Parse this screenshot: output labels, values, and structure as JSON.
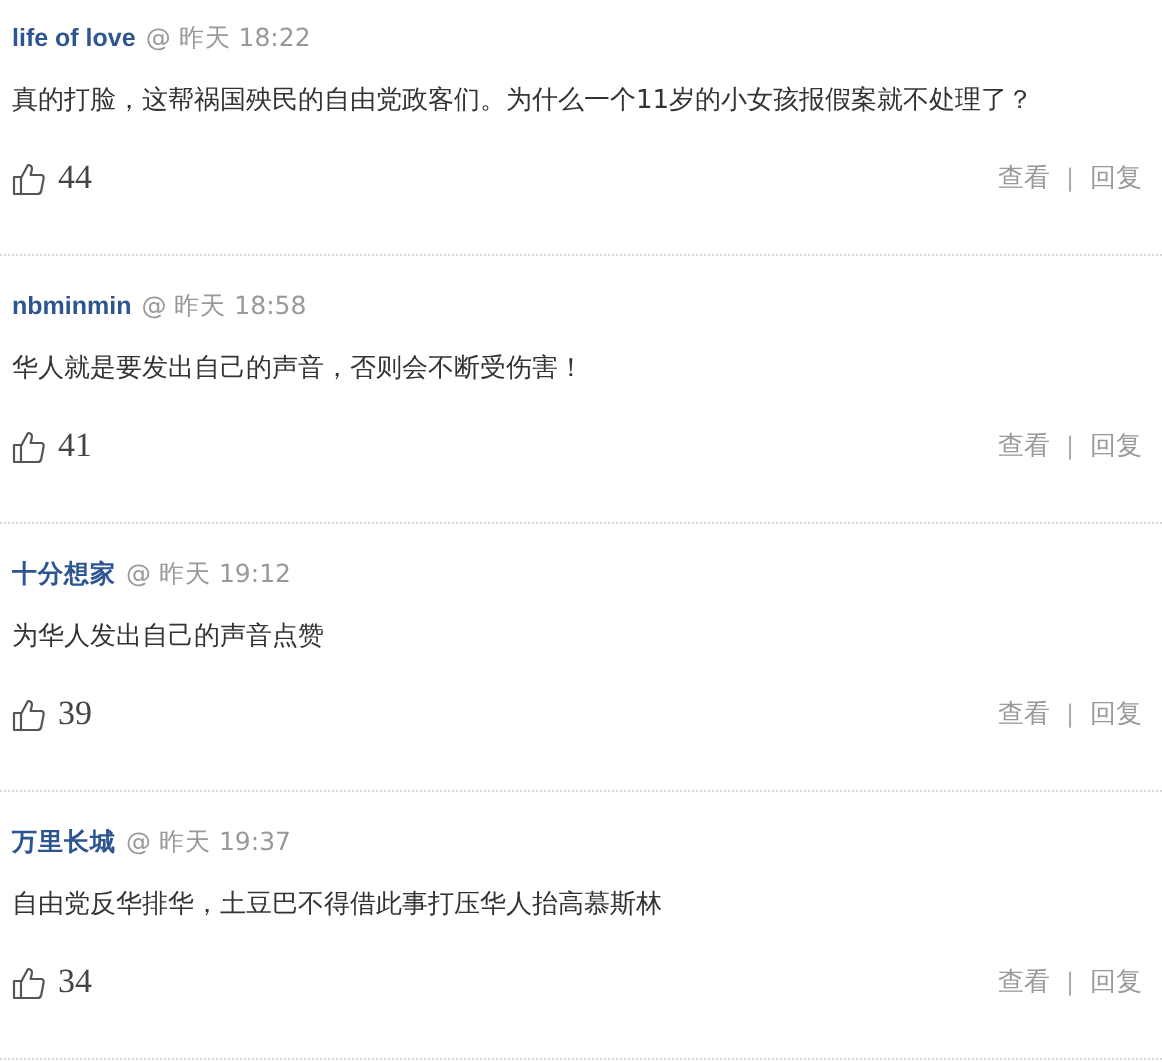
{
  "comments": [
    {
      "author": "life of love",
      "at": "@",
      "date": "昨天",
      "time": "18:22",
      "text": "真的打脸，这帮祸国殃民的自由党政客们。为什么一个11岁的小女孩报假案就不处理了？",
      "likes": "44",
      "view": "查看",
      "separator": "|",
      "reply": "回复"
    },
    {
      "author": "nbminmin",
      "at": "@",
      "date": "昨天",
      "time": "18:58",
      "text": "华人就是要发出自己的声音，否则会不断受伤害！",
      "likes": "41",
      "view": "查看",
      "separator": "|",
      "reply": "回复"
    },
    {
      "author": "十分想家",
      "at": "@",
      "date": "昨天",
      "time": "19:12",
      "text": "为华人发出自己的声音点赞",
      "likes": "39",
      "view": "查看",
      "separator": "|",
      "reply": "回复"
    },
    {
      "author": "万里长城",
      "at": "@",
      "date": "昨天",
      "time": "19:37",
      "text": "自由党反华排华，土豆巴不得借此事打压华人抬高慕斯林",
      "likes": "34",
      "view": "查看",
      "separator": "|",
      "reply": "回复"
    }
  ]
}
